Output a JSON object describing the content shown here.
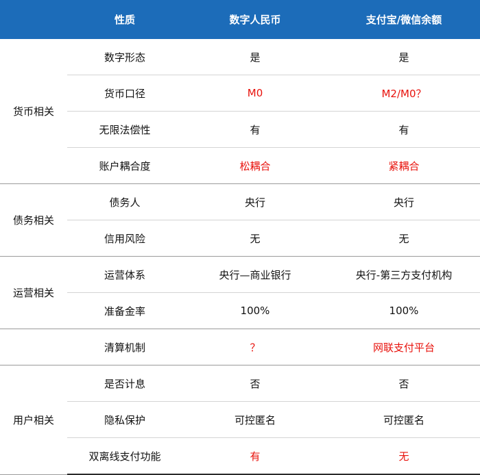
{
  "header": {
    "col0": "",
    "col1": "性质",
    "col2": "数字人民币",
    "col3": "支付宝/微信余额"
  },
  "groups": [
    {
      "name": "货币相关",
      "rows": [
        {
          "property": "数字形态",
          "dcep": "是",
          "alipay": "是"
        },
        {
          "property": "货币口径",
          "dcep": "M0",
          "alipay": "M2/M0？"
        },
        {
          "property": "无限法偿性",
          "dcep": "有",
          "alipay": "有"
        },
        {
          "property": "账户耦合度",
          "dcep": "松耦合",
          "alipay": "紧耦合"
        }
      ]
    },
    {
      "name": "债务相关",
      "rows": [
        {
          "property": "债务人",
          "dcep": "央行",
          "alipay": "央行"
        },
        {
          "property": "信用风险",
          "dcep": "无",
          "alipay": "无"
        }
      ]
    },
    {
      "name": "运营相关",
      "rows": [
        {
          "property": "运营体系",
          "dcep": "央行—商业银行",
          "alipay": "央行-第三方支付机构"
        },
        {
          "property": "准备金率",
          "dcep": "100%",
          "alipay": "100%"
        },
        {
          "property": "清算机制",
          "dcep": "？",
          "alipay": "网联支付平台"
        }
      ]
    },
    {
      "name": "用户相关",
      "rows": [
        {
          "property": "是否计息",
          "dcep": "否",
          "alipay": "否"
        },
        {
          "property": "隐私保护",
          "dcep": "可控匿名",
          "alipay": "可控匿名"
        },
        {
          "property": "双离线支付功能",
          "dcep": "有",
          "alipay": "无"
        }
      ]
    }
  ],
  "colors": {
    "header_bg": "#1c6cb9",
    "header_text": "#ffffff",
    "highlight": "#e8120c",
    "text": "#111111"
  }
}
